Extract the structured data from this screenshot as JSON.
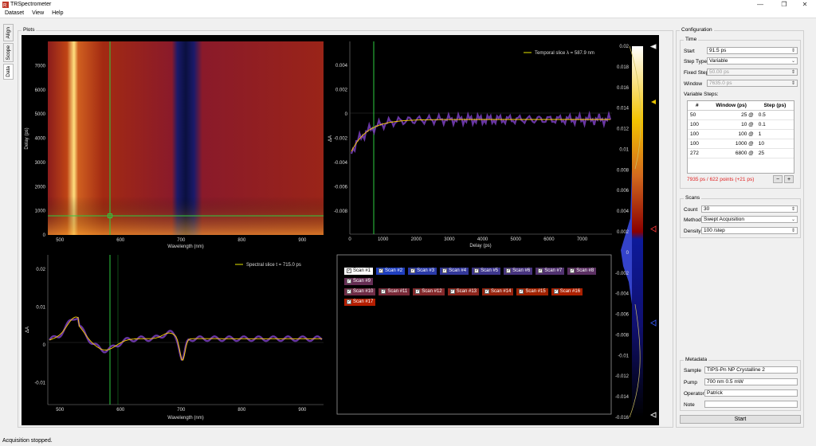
{
  "window": {
    "title": "TRSpectrometer",
    "min": "—",
    "max": "❐",
    "close": "✕"
  },
  "menu": [
    "Dataset",
    "View",
    "Help"
  ],
  "sidetabs": [
    {
      "label": "Align"
    },
    {
      "label": "Scope"
    },
    {
      "label": "Data"
    }
  ],
  "plots_group": "Plots",
  "config_group": "Configuration",
  "time": {
    "title": "Time",
    "start_label": "Start",
    "start_value": "91.5 ps",
    "steptype_label": "Step Type",
    "steptype_value": "Variable",
    "fixed_label": "Fixed Step",
    "fixed_value": "50.00 ps",
    "window_label": "Window",
    "window_value": "7635.0 ps",
    "variable_label": "Variable Steps:",
    "columns": [
      "#",
      "Window (ps)",
      "Step (ps)"
    ],
    "rows": [
      [
        "50",
        "25 @",
        "0.5"
      ],
      [
        "100",
        "10 @",
        "0.1"
      ],
      [
        "100",
        "100 @",
        "1"
      ],
      [
        "100",
        "1000 @",
        "10"
      ],
      [
        "272",
        "6800 @",
        "25"
      ]
    ],
    "summary": "7935 ps / 622 points (+21 ps)",
    "minus": "−",
    "plus": "+"
  },
  "scans": {
    "title": "Scans",
    "count_label": "Count",
    "count_value": "30",
    "method_label": "Method",
    "method_value": "Swept Acquisition",
    "density_label": "Density",
    "density_value": "100 /step"
  },
  "metadata": {
    "title": "Metadata",
    "sample_label": "Sample",
    "sample_value": "TIPS-Pn NP Crystalline 2",
    "pump_label": "Pump",
    "pump_value": "700 nm 0.5 mW",
    "operator_label": "Operator",
    "operator_value": "Patrick",
    "note_label": "Note",
    "note_value": ""
  },
  "start_button": "Start",
  "status": "Acquisition stopped.",
  "heatmap": {
    "xlabel": "Wavelength (nm)",
    "ylabel": "Delay (ps)",
    "xticks": [
      "500",
      "600",
      "700",
      "800",
      "900"
    ],
    "yticks": [
      "0",
      "1000",
      "2000",
      "3000",
      "4000",
      "5000",
      "6000",
      "7000"
    ]
  },
  "temporal": {
    "legend": "Temporal slice λ = 587.9 nm",
    "xlabel": "Delay (ps)",
    "ylabel": "ΔA",
    "xticks": [
      "0",
      "1000",
      "2000",
      "3000",
      "4000",
      "5000",
      "6000",
      "7000"
    ],
    "yticks": [
      "0.004",
      "0.002",
      "0",
      "-0.002",
      "-0.004",
      "-0.006",
      "-0.008"
    ]
  },
  "spectral": {
    "legend": "Spectral slice t = 715.0 ps",
    "xlabel": "Wavelength (nm)",
    "ylabel": "ΔA",
    "xticks": [
      "500",
      "600",
      "700",
      "800",
      "900"
    ],
    "yticks": [
      "0.02",
      "0.01",
      "0",
      "-0.01"
    ]
  },
  "colorbar": {
    "ticks": [
      "0.02",
      "0.018",
      "0.016",
      "0.014",
      "0.012",
      "0.01",
      "0.008",
      "0.006",
      "0.004",
      "0.002",
      "0",
      "-0.002",
      "-0.004",
      "-0.006",
      "-0.008",
      "-0.01",
      "-0.012",
      "-0.014",
      "-0.016"
    ]
  },
  "scan_list": [
    "Scan #1",
    "Scan #2",
    "Scan #3",
    "Scan #4",
    "Scan #5",
    "Scan #6",
    "Scan #7",
    "Scan #8",
    "Scan #9",
    "Scan #10",
    "Scan #11",
    "Scan #12",
    "Scan #13",
    "Scan #14",
    "Scan #15",
    "Scan #16",
    "Scan #17"
  ],
  "scan_colors": [
    "#ffffff",
    "#1f3fbf",
    "#2a3aa8",
    "#33389a",
    "#3d368c",
    "#47347e",
    "#513270",
    "#5b3062",
    "#652e54",
    "#6f2c46",
    "#792a38",
    "#83282a",
    "#8d261c",
    "#97240e",
    "#a12200",
    "#ab2000",
    "#b51e00"
  ]
}
